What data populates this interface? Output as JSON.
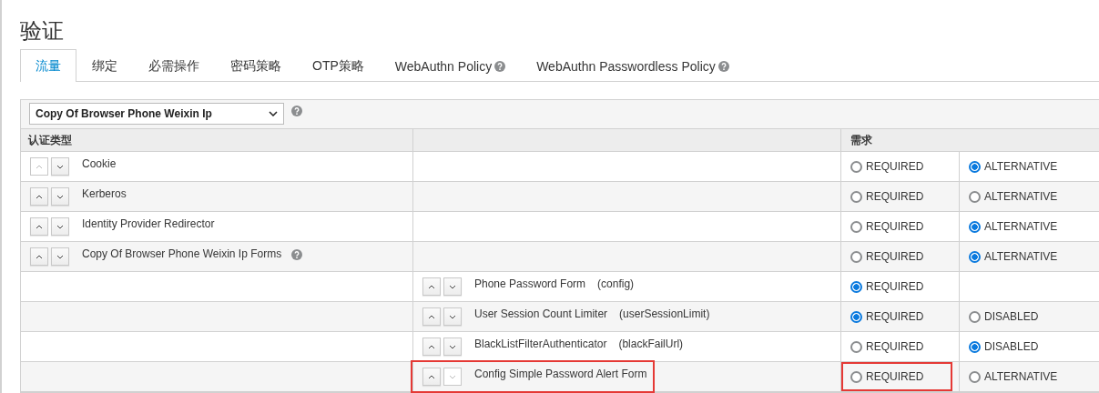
{
  "title": "验证",
  "tabs": [
    {
      "label": "流量",
      "selected": true,
      "help": false
    },
    {
      "label": "绑定",
      "selected": false,
      "help": false
    },
    {
      "label": "必需操作",
      "selected": false,
      "help": false
    },
    {
      "label": "密码策略",
      "selected": false,
      "help": false
    },
    {
      "label": "OTP策略",
      "selected": false,
      "help": false
    },
    {
      "label": "WebAuthn Policy",
      "selected": false,
      "help": true
    },
    {
      "label": "WebAuthn Passwordless Policy",
      "selected": false,
      "help": true
    }
  ],
  "flow_select": {
    "value": "Copy Of Browser Phone Weixin Ip",
    "help": true
  },
  "table": {
    "columns": [
      "认证类型",
      "需求"
    ],
    "rows": [
      {
        "name": "Cookie",
        "up_disabled": true,
        "down_disabled": false,
        "options": [
          {
            "label": "REQUIRED",
            "selected": false,
            "highlighted": false
          },
          {
            "label": "ALTERNATIVE",
            "selected": true,
            "highlighted": false
          }
        ]
      },
      {
        "name": "Kerberos",
        "up_disabled": false,
        "down_disabled": false,
        "options": [
          {
            "label": "REQUIRED",
            "selected": false,
            "highlighted": false
          },
          {
            "label": "ALTERNATIVE",
            "selected": false,
            "highlighted": false
          }
        ]
      },
      {
        "name": "Identity Provider Redirector",
        "up_disabled": false,
        "down_disabled": false,
        "options": [
          {
            "label": "REQUIRED",
            "selected": false,
            "highlighted": false
          },
          {
            "label": "ALTERNATIVE",
            "selected": true,
            "highlighted": false
          }
        ]
      },
      {
        "name": "Copy Of Browser Phone Weixin Ip Forms",
        "up_disabled": false,
        "down_disabled": false,
        "help": true,
        "options": [
          {
            "label": "REQUIRED",
            "selected": false,
            "highlighted": false
          },
          {
            "label": "ALTERNATIVE",
            "selected": true,
            "highlighted": false
          }
        ],
        "children": [
          {
            "name": "Phone Password Form",
            "detail": "(config)",
            "up_disabled": false,
            "down_disabled": false,
            "options": [
              {
                "label": "REQUIRED",
                "selected": true,
                "highlighted": false
              }
            ]
          },
          {
            "name": "User Session Count Limiter",
            "detail": "(userSessionLimit)",
            "up_disabled": false,
            "down_disabled": false,
            "options": [
              {
                "label": "REQUIRED",
                "selected": true,
                "highlighted": false
              },
              {
                "label": "DISABLED",
                "selected": false,
                "highlighted": false
              }
            ]
          },
          {
            "name": "BlackListFilterAuthenticator",
            "detail": "(blackFailUrl)",
            "up_disabled": false,
            "down_disabled": false,
            "options": [
              {
                "label": "REQUIRED",
                "selected": false,
                "highlighted": false
              },
              {
                "label": "DISABLED",
                "selected": true,
                "highlighted": false
              }
            ]
          },
          {
            "name": "Config Simple Password Alert Form",
            "up_disabled": false,
            "down_disabled": true,
            "highlighted": true,
            "options": [
              {
                "label": "REQUIRED",
                "selected": false,
                "highlighted": true
              },
              {
                "label": "ALTERNATIVE",
                "selected": false,
                "highlighted": false
              }
            ]
          }
        ]
      }
    ]
  }
}
